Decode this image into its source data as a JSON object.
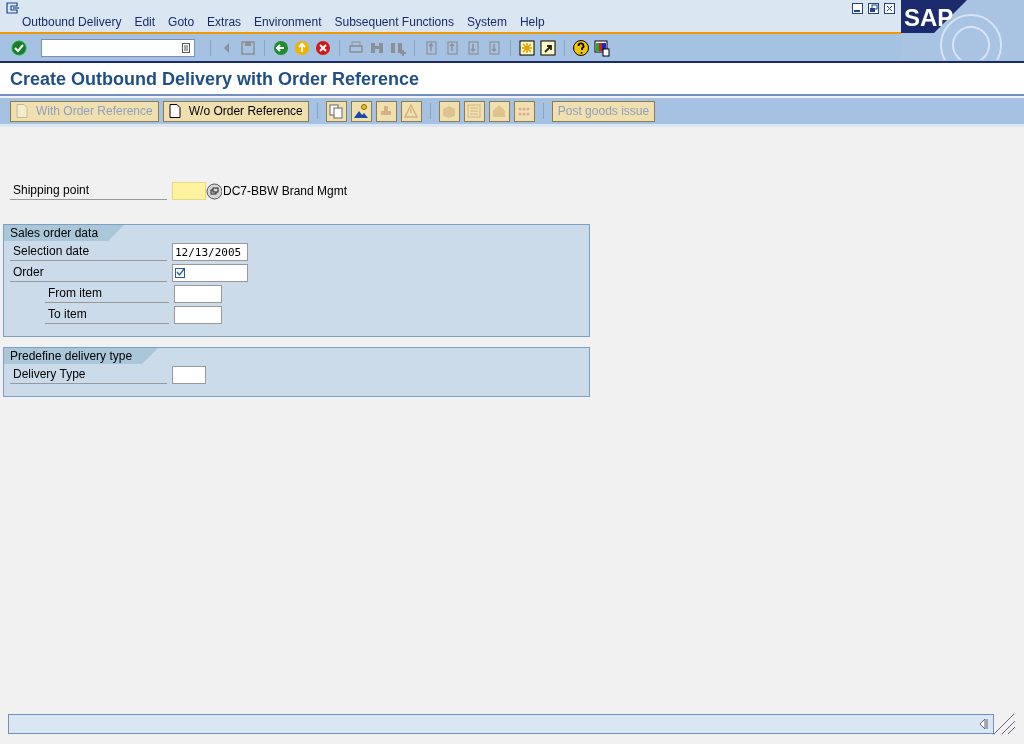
{
  "logo_text": "SAP",
  "menu": [
    "Outbound Delivery",
    "Edit",
    "Goto",
    "Extras",
    "Environment",
    "Subsequent Functions",
    "System",
    "Help"
  ],
  "standard_toolbar": [
    {
      "kind": "enter",
      "disabled": false
    },
    {
      "kind": "command"
    },
    {
      "kind": "sep"
    },
    {
      "kind": "back-small",
      "disabled": true
    },
    {
      "kind": "save",
      "disabled": true
    },
    {
      "kind": "sep"
    },
    {
      "kind": "back",
      "disabled": false
    },
    {
      "kind": "exit",
      "disabled": false
    },
    {
      "kind": "cancel",
      "disabled": false
    },
    {
      "kind": "sep"
    },
    {
      "kind": "print",
      "disabled": true
    },
    {
      "kind": "find",
      "disabled": true
    },
    {
      "kind": "find-next",
      "disabled": true
    },
    {
      "kind": "sep"
    },
    {
      "kind": "first",
      "disabled": true
    },
    {
      "kind": "prev",
      "disabled": true
    },
    {
      "kind": "next",
      "disabled": true
    },
    {
      "kind": "last",
      "disabled": true
    },
    {
      "kind": "sep"
    },
    {
      "kind": "session",
      "disabled": false
    },
    {
      "kind": "shortcut",
      "disabled": false
    },
    {
      "kind": "sep"
    },
    {
      "kind": "help",
      "disabled": false
    },
    {
      "kind": "layout",
      "disabled": false
    }
  ],
  "title": "Create Outbound Delivery with Order Reference",
  "app_toolbar": [
    {
      "kind": "text",
      "label": "With Order Reference",
      "disabled": true
    },
    {
      "kind": "text",
      "label": "W/o Order Reference",
      "disabled": false
    },
    {
      "kind": "sep"
    },
    {
      "kind": "copy",
      "disabled": false
    },
    {
      "kind": "picture",
      "disabled": false
    },
    {
      "kind": "stamp",
      "disabled": true
    },
    {
      "kind": "warning",
      "disabled": true
    },
    {
      "kind": "sep"
    },
    {
      "kind": "box",
      "disabled": true
    },
    {
      "kind": "list",
      "disabled": true
    },
    {
      "kind": "house",
      "disabled": true
    },
    {
      "kind": "grid",
      "disabled": true
    },
    {
      "kind": "sep"
    },
    {
      "kind": "plain",
      "label": "Post goods issue",
      "disabled": true
    }
  ],
  "shipping_point": {
    "label": "Shipping point",
    "highlighted": true,
    "description": "DC7-BBW Brand Mgmt"
  },
  "groups": [
    {
      "title": "Sales order data",
      "fields": [
        {
          "label": "Selection date",
          "kind": "date",
          "value": "12/13/2005",
          "required": false
        },
        {
          "label": "Order",
          "kind": "order",
          "required": true,
          "children": [
            {
              "label": "From item",
              "kind": "item",
              "required": false
            },
            {
              "label": "To item",
              "kind": "item",
              "required": false
            }
          ]
        }
      ]
    },
    {
      "title": "Predefine delivery type",
      "fields": [
        {
          "label": "Delivery Type",
          "kind": "type",
          "required": false
        }
      ]
    }
  ]
}
